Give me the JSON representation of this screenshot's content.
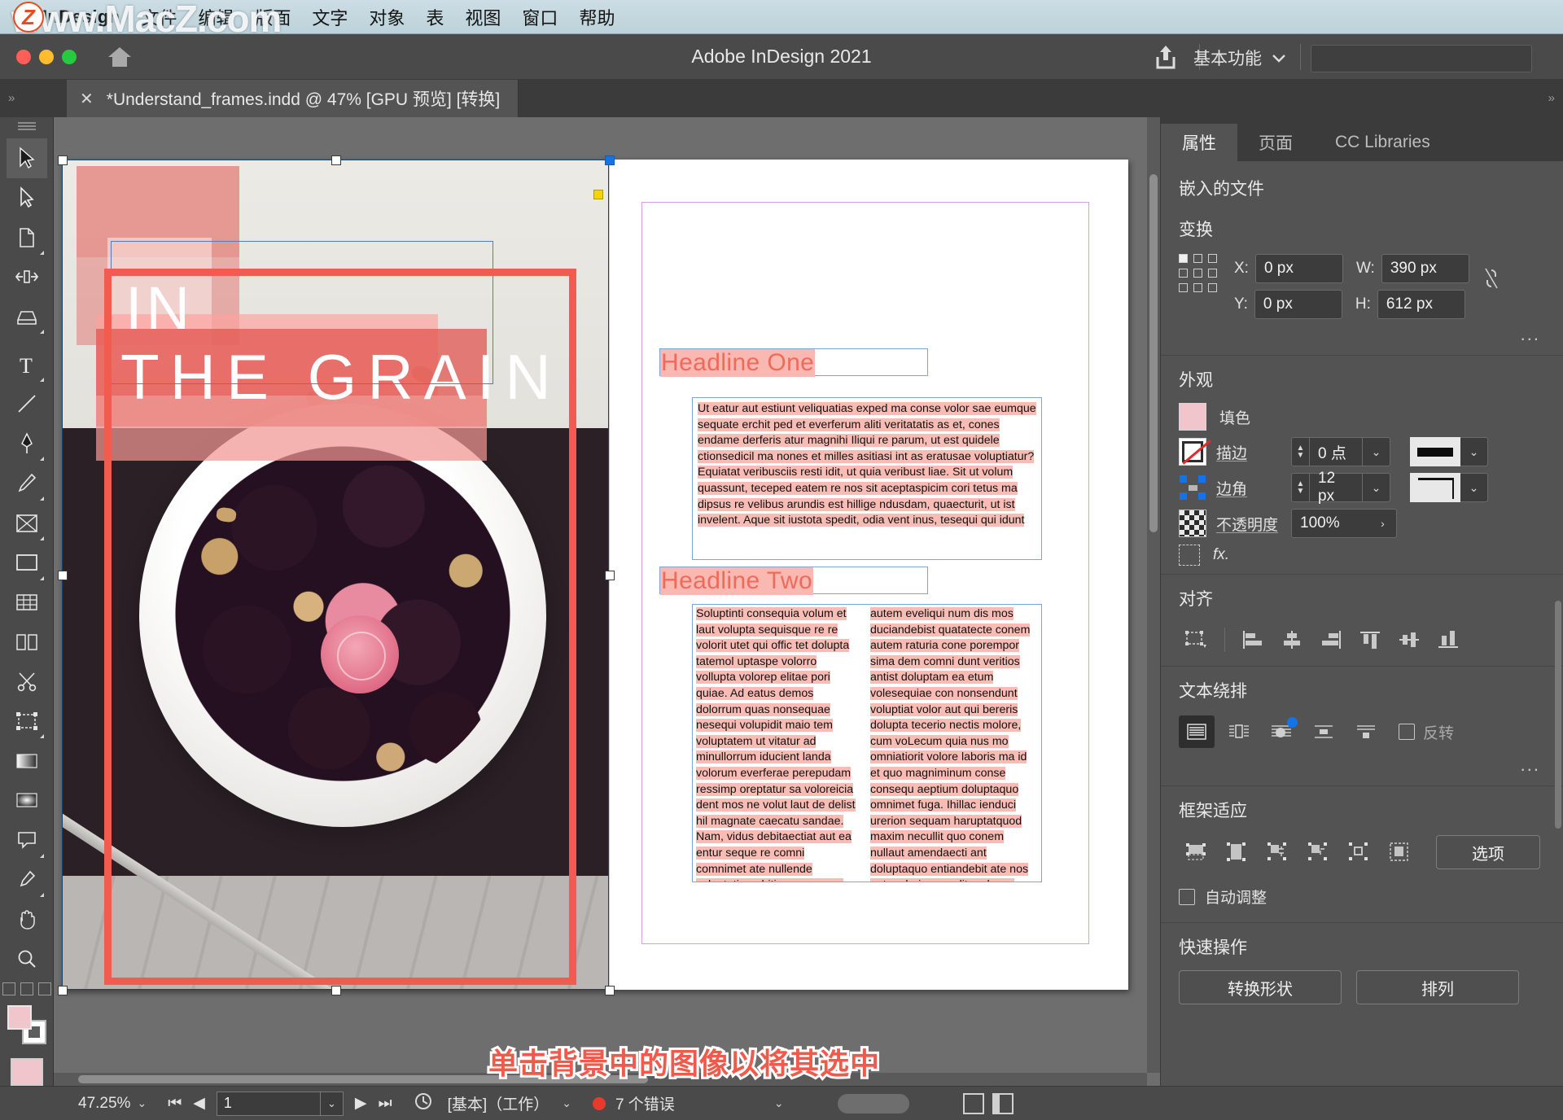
{
  "menubar": {
    "app_name": "InDesign",
    "items": [
      "文件",
      "编辑",
      "版面",
      "文字",
      "对象",
      "表",
      "视图",
      "窗口",
      "帮助"
    ]
  },
  "watermark": {
    "text": "www.MacZ.com",
    "badge": "Z"
  },
  "titlebar": {
    "title": "Adobe InDesign 2021",
    "workspace": "基本功能",
    "share_icon": "share-icon",
    "home_icon": "home-icon",
    "search_placeholder": ""
  },
  "document_tab": {
    "close_label": "✕",
    "name": "*Understand_frames.indd @ 47% [GPU 预览] [转换]"
  },
  "toolbar": {
    "tools": [
      {
        "name": "selection-tool",
        "selected": true
      },
      {
        "name": "direct-selection-tool",
        "selected": false
      },
      {
        "name": "page-tool",
        "selected": false
      },
      {
        "name": "gap-tool",
        "selected": false
      },
      {
        "name": "content-collector-tool",
        "selected": false
      },
      {
        "name": "type-tool",
        "selected": false
      },
      {
        "name": "line-tool",
        "selected": false
      },
      {
        "name": "pen-tool",
        "selected": false
      },
      {
        "name": "pencil-tool",
        "selected": false
      },
      {
        "name": "frame-tool",
        "selected": false
      },
      {
        "name": "rectangle-tool",
        "selected": false
      },
      {
        "name": "table-tool",
        "selected": false
      },
      {
        "name": "column-tool",
        "selected": false
      },
      {
        "name": "scissors-tool",
        "selected": false
      },
      {
        "name": "free-transform-tool",
        "selected": false
      },
      {
        "name": "gradient-swatch-tool",
        "selected": false
      },
      {
        "name": "gradient-feather-tool",
        "selected": false
      },
      {
        "name": "note-tool",
        "selected": false
      },
      {
        "name": "eyedropper-tool",
        "selected": false
      },
      {
        "name": "hand-tool",
        "selected": false
      },
      {
        "name": "zoom-tool",
        "selected": false
      }
    ]
  },
  "document": {
    "cover": {
      "word_top": "IN",
      "word_bottom": "THE GRAIN"
    },
    "headline_one": "Headline One",
    "headline_one_body": "Ut eatur aut estiunt veliquatias exped ma conse volor sae eumque sequate erchit ped et everferum aliti veritatatis as et, cones endame derferis atur magnihi Iliqui re parum, ut est quidele ctionsedicil ma nones et milles asitiasi int as eratusae voluptiatur? Equiatat veribusciis resti idit, ut quia veribust liae. Sit ut volum quassunt, teceped eatem re nos sit aceptaspicim cori tetus ma dipsus re velibus arundis est hillige ndusdam, quaecturit, ut ist invelent. Aque sit iustota spedit, odia vent inus, tesequi qui idunt",
    "headline_two": "Headline Two",
    "headline_two_col1": "Soluptinti consequia volum et laut volupta sequisque re re volorit utet qui offic tet dolupta tatemol uptaspe volorro vollupta volorep elitae pori quiae. Ad eatus demos dolorrum quas nonsequae nesequi volupidit maio tem voluptatem ut vitatur ad minullorrum iducient landa volorum everferae perepudam ressimp oreptatur sa voloreicia dent mos ne volut laut de delist hil magnate caecatu sandae. Nam, vidus debitaectiat aut ea entur seque re comni comnimet ate nullende voluptatia nobitius exerum re nus est, comnis et acid quasi consequ assitatumquo te corunt, unt aut reperias dici corerum aut aut est, qui nis doloreh enienis",
    "headline_two_col2": "autem eveliqui num dis mos duciandebist quatatecte conem autem raturia cone porempor sima dem comni dunt veritios antist doluptam ea etum volesequiae con nonsendunt voluptiat volor aut qui bereris dolupta tecerio nectis molore, cum voLecum quia nus mo omniatiorit volore laboris ma id et quo magniminum conse consequ aeptium doluptaquo omnimet fuga. Ihillac ienduci urerion sequam haruptatquod maxim necullit quo conem nullaut amendaecti ant doluptaquo entiandebit ate nos autas deria cum dit molecus doloria essedi re nonseque consequis eum ad quis incto occus ent et, solorro ipit voluptatur a volupta"
  },
  "annotation": {
    "caption": "单击背景中的图像以将其选中",
    "highlight_color": "#f15c4e"
  },
  "right_panel": {
    "tabs": [
      {
        "label": "属性",
        "active": true
      },
      {
        "label": "页面",
        "active": false
      },
      {
        "label": "CC Libraries",
        "active": false
      }
    ],
    "object_type": "嵌入的文件",
    "transform": {
      "title": "变换",
      "x_label": "X:",
      "x_value": "0 px",
      "y_label": "Y:",
      "y_value": "0 px",
      "w_label": "W:",
      "w_value": "390 px",
      "h_label": "H:",
      "h_value": "612 px",
      "constrain_icon": "unlink-icon",
      "more_label": "..."
    },
    "appearance": {
      "title": "外观",
      "fill_label": "填色",
      "fill_color": "#f0c5cc",
      "stroke_label": "描边",
      "stroke_weight": "0 点",
      "stroke_color": "#000000",
      "corner_label": "边角",
      "corner_value": "12 px",
      "opacity_label": "不透明度",
      "opacity_value": "100%",
      "fx_label": "fx."
    },
    "align": {
      "title": "对齐",
      "icons": [
        "align-to-selection-icon",
        "align-left-icon",
        "align-horizontal-center-icon",
        "align-right-icon",
        "align-top-icon",
        "align-vertical-center-icon",
        "align-bottom-icon"
      ]
    },
    "text_wrap": {
      "title": "文本绕排",
      "invert_label": "反转",
      "icons": [
        "wrap-none-icon",
        "wrap-bounding-box-icon",
        "wrap-object-shape-icon",
        "wrap-jump-object-icon",
        "wrap-jump-next-column-icon"
      ],
      "active_index": 0
    },
    "frame_fitting": {
      "title": "框架适应",
      "options_label": "选项",
      "auto_fit_label": "自动调整",
      "auto_fit_checked": false,
      "icons": [
        "fill-frame-proportionally-icon",
        "fit-content-proportionally-icon",
        "fit-frame-to-content-icon",
        "fit-content-to-frame-icon",
        "center-content-icon",
        "content-aware-fit-icon"
      ]
    },
    "quick_actions": {
      "title": "快速操作",
      "convert_shape_label": "转换形状",
      "arrange_label": "排列"
    }
  },
  "statusbar": {
    "zoom": "47.25%",
    "page_number": "1",
    "preflight_profile": "[基本]（工作）",
    "errors": "7 个错误",
    "first_icon": "first-page-icon",
    "prev_icon": "prev-page-icon",
    "next_icon": "next-page-icon",
    "last_icon": "last-page-icon"
  }
}
